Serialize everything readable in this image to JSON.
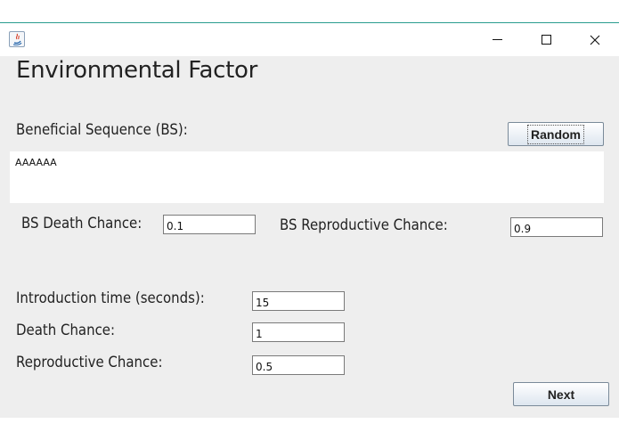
{
  "window": {
    "controls": {
      "minimize": "–",
      "maximize": "□",
      "close": "×"
    }
  },
  "form": {
    "title": "Environmental Factor",
    "beneficial_sequence_label": "Beneficial Sequence (BS):",
    "random_button": "Random",
    "sequence_value": "AAAAAA",
    "bs_death_chance_label": "BS Death Chance:",
    "bs_death_chance_value": "0.1",
    "bs_reproductive_chance_label": "BS Reproductive Chance:",
    "bs_reproductive_chance_value": "0.9",
    "introduction_time_label": "Introduction time (seconds):",
    "introduction_time_value": "15",
    "death_chance_label": "Death Chance:",
    "death_chance_value": "1",
    "reproductive_chance_label": "Reproductive Chance:",
    "reproductive_chance_value": "0.5",
    "next_button": "Next"
  }
}
